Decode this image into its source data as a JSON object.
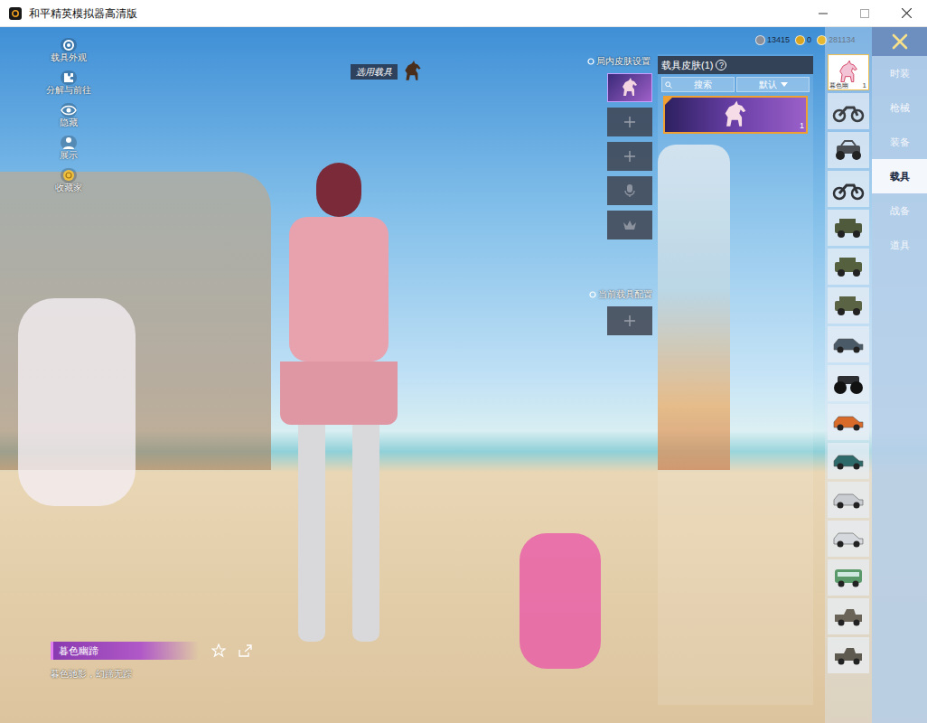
{
  "window": {
    "title": "和平精英模拟器高清版"
  },
  "side_menu": [
    {
      "label": "载具外观"
    },
    {
      "label": "分解与前往"
    },
    {
      "label": "隐藏"
    },
    {
      "label": "展示"
    },
    {
      "label": "收藏家"
    }
  ],
  "currency": [
    {
      "amount": "13415",
      "color": "#8a8f99"
    },
    {
      "amount": "0",
      "color": "#d9a520"
    },
    {
      "amount": "281134",
      "color": "#e6b830"
    }
  ],
  "vehicle_label": "选用载具",
  "in_match_skins": {
    "title": "局内皮肤设置",
    "slots": [
      {
        "kind": "skin",
        "selected": true
      },
      {
        "kind": "add",
        "selected": false
      },
      {
        "kind": "add",
        "selected": false
      },
      {
        "kind": "voice",
        "selected": false
      },
      {
        "kind": "crown",
        "selected": false
      }
    ]
  },
  "vehicle_config": {
    "title": "当前载具配置",
    "slots": [
      {
        "kind": "add",
        "selected": false
      }
    ]
  },
  "skin_panel": {
    "title": "载具皮肤(1)",
    "help": "?",
    "search": {
      "placeholder": "搜索"
    },
    "sort": "默认",
    "items": [
      {
        "count": "1",
        "selected": true
      }
    ]
  },
  "vehicles": [
    {
      "kind": "horse",
      "selected": true,
      "label": "暮色幽",
      "count": "1",
      "color": "#f2c4d6"
    },
    {
      "kind": "motorcycle",
      "selected": false,
      "color": "#3a3d42"
    },
    {
      "kind": "buggy",
      "selected": false,
      "color": "#4a4d52"
    },
    {
      "kind": "motorcycle",
      "selected": false,
      "color": "#2f3236"
    },
    {
      "kind": "jeep",
      "selected": false,
      "color": "#4f5a3c"
    },
    {
      "kind": "jeep",
      "selected": false,
      "color": "#55603f"
    },
    {
      "kind": "jeep",
      "selected": false,
      "color": "#5a6444"
    },
    {
      "kind": "car",
      "selected": false,
      "color": "#4a5a66"
    },
    {
      "kind": "monster",
      "selected": false,
      "color": "#2c2e31"
    },
    {
      "kind": "car",
      "selected": false,
      "color": "#d86a2a"
    },
    {
      "kind": "car",
      "selected": false,
      "color": "#2f6a6a"
    },
    {
      "kind": "car",
      "selected": false,
      "color": "#c9ccd0"
    },
    {
      "kind": "car",
      "selected": false,
      "color": "#d5d8dc"
    },
    {
      "kind": "van",
      "selected": false,
      "color": "#5a9a6a"
    },
    {
      "kind": "pickup",
      "selected": false,
      "color": "#6a6458"
    },
    {
      "kind": "pickup",
      "selected": false,
      "color": "#5f5a50"
    }
  ],
  "categories": [
    {
      "label": "时装",
      "selected": false
    },
    {
      "label": "枪械",
      "selected": false
    },
    {
      "label": "装备",
      "selected": false
    },
    {
      "label": "载具",
      "selected": true
    },
    {
      "label": "战备",
      "selected": false
    },
    {
      "label": "道具",
      "selected": false
    }
  ],
  "selected_skin": {
    "name": "暮色幽蹄",
    "description": "暮色驰影，幻蹄无踪"
  }
}
